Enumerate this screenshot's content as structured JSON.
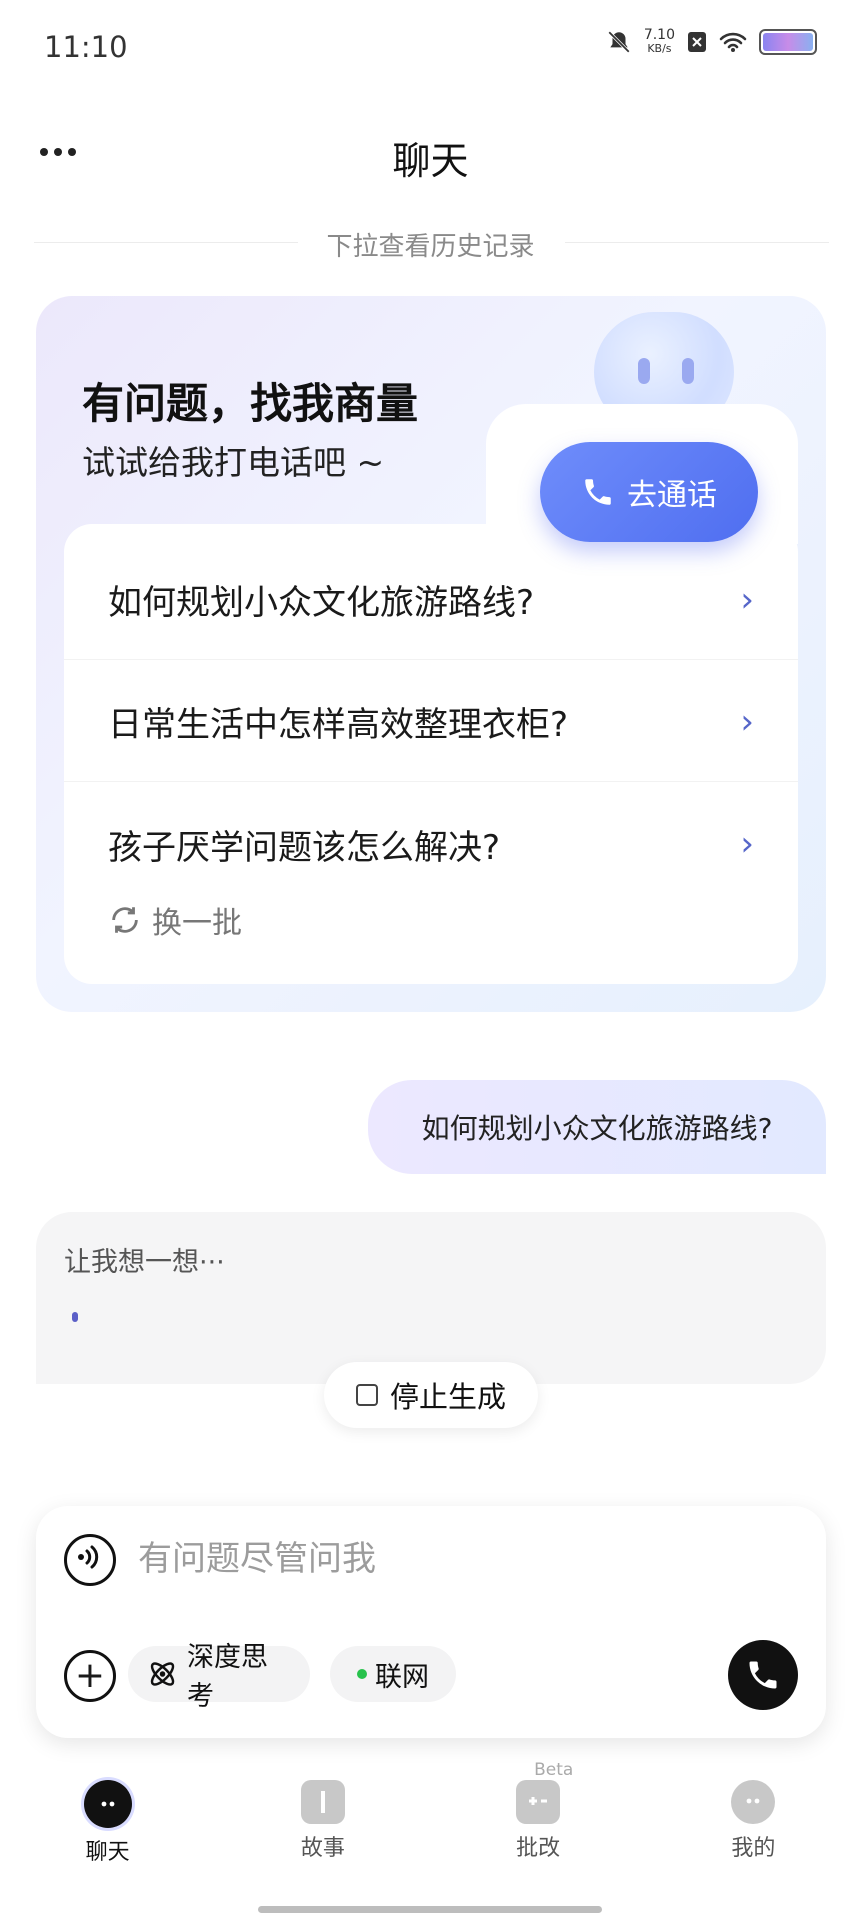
{
  "status_bar": {
    "time": "11:10",
    "speed_value": "7.10",
    "speed_unit": "KB/s"
  },
  "header": {
    "title": "聊天",
    "pull_hint": "下拉查看历史记录"
  },
  "promo": {
    "headline": "有问题，找我商量",
    "subline": "试试给我打电话吧 ~",
    "call_button_label": "去通话",
    "questions": [
      "如何规划小众文化旅游路线?",
      "日常生活中怎样高效整理衣柜?",
      "孩子厌学问题该怎么解决?"
    ],
    "refresh_label": "换一批"
  },
  "chat": {
    "user_message": "如何规划小众文化旅游路线?",
    "ai_status": "让我想一想···",
    "stop_label": "停止生成"
  },
  "composer": {
    "placeholder": "有问题尽管问我",
    "deep_think_label": "深度思考",
    "web_label": "联网"
  },
  "nav": {
    "items": [
      {
        "label": "聊天",
        "icon": "chat-bubble-icon",
        "active": true
      },
      {
        "label": "故事",
        "icon": "book-icon",
        "active": false
      },
      {
        "label": "批改",
        "icon": "grading-icon",
        "active": false,
        "badge": "Beta"
      },
      {
        "label": "我的",
        "icon": "profile-icon",
        "active": false
      }
    ]
  },
  "colors": {
    "accent": "#4f6ef0",
    "chevron": "#5666c9",
    "online": "#27c24c"
  }
}
